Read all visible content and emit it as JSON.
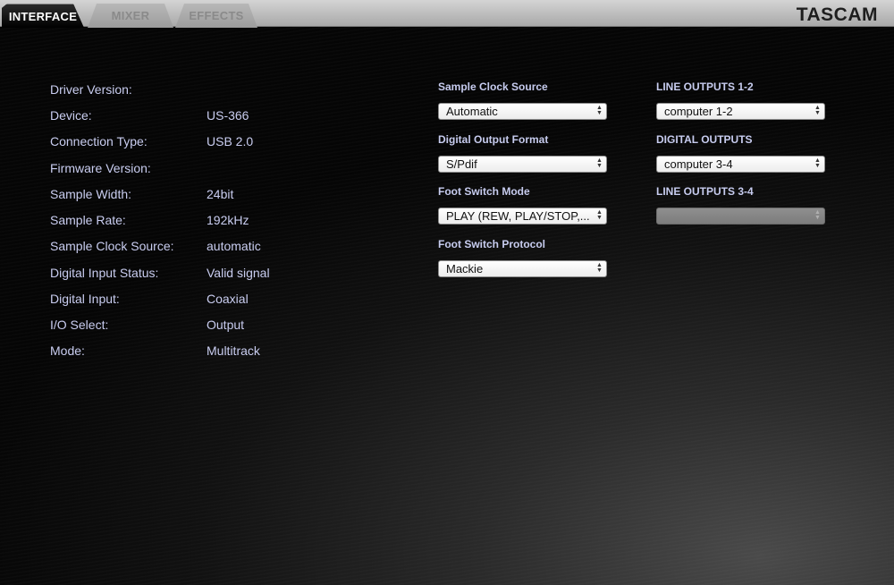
{
  "tabs": [
    {
      "label": "INTERFACE",
      "active": true
    },
    {
      "label": "MIXER",
      "active": false
    },
    {
      "label": "EFFECTS",
      "active": false
    }
  ],
  "brand": "TASCAM",
  "info": [
    {
      "label": "Driver Version:",
      "value": ""
    },
    {
      "label": "Device:",
      "value": "US-366"
    },
    {
      "label": "Connection Type:",
      "value": "USB 2.0"
    },
    {
      "label": "Firmware Version:",
      "value": ""
    },
    {
      "label": "Sample Width:",
      "value": "24bit"
    },
    {
      "label": "Sample Rate:",
      "value": "192kHz"
    },
    {
      "label": "Sample Clock Source:",
      "value": "automatic"
    },
    {
      "label": "Digital Input Status:",
      "value": "Valid signal"
    },
    {
      "label": "Digital Input:",
      "value": "Coaxial"
    },
    {
      "label": "I/O Select:",
      "value": "Output"
    },
    {
      "label": "Mode:",
      "value": "Multitrack"
    }
  ],
  "settings": {
    "sample_clock_source": {
      "label": "Sample Clock Source",
      "value": "Automatic"
    },
    "digital_output_format": {
      "label": "Digital Output Format",
      "value": "S/Pdif"
    },
    "foot_switch_mode": {
      "label": "Foot Switch Mode",
      "value": "PLAY (REW, PLAY/STOP,..."
    },
    "foot_switch_protocol": {
      "label": "Foot Switch Protocol",
      "value": "Mackie"
    }
  },
  "outputs": {
    "line_outputs_1_2": {
      "label": "LINE OUTPUTS 1-2",
      "value": "computer 1-2"
    },
    "digital_outputs": {
      "label": "DIGITAL OUTPUTS",
      "value": "computer 3-4"
    },
    "line_outputs_3_4": {
      "label": "LINE OUTPUTS 3-4",
      "value": "",
      "disabled": true
    }
  },
  "icons": {
    "select_arrows": "up-down-arrows-icon"
  }
}
